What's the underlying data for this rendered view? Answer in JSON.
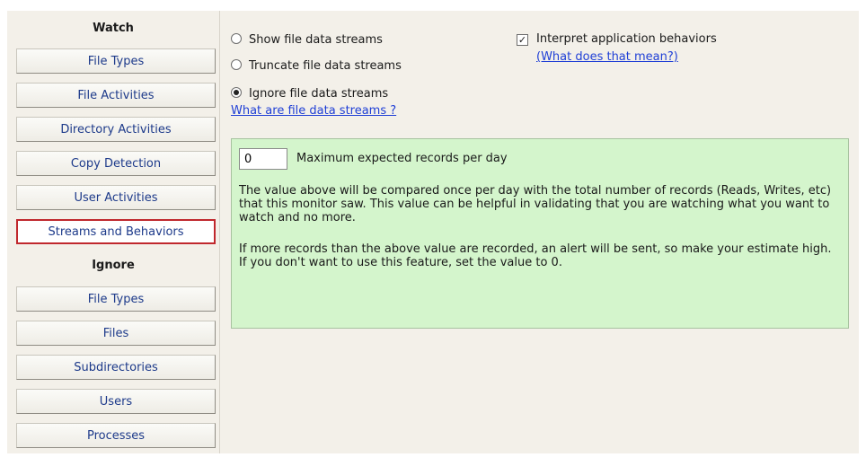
{
  "nav": {
    "watch_heading": "Watch",
    "watch_items": [
      {
        "label": "File Types"
      },
      {
        "label": "File Activities"
      },
      {
        "label": "Directory Activities"
      },
      {
        "label": "Copy Detection"
      },
      {
        "label": "User Activities"
      },
      {
        "label": "Streams and Behaviors",
        "selected": true
      }
    ],
    "ignore_heading": "Ignore",
    "ignore_items": [
      {
        "label": "File Types"
      },
      {
        "label": "Files"
      },
      {
        "label": "Subdirectories"
      },
      {
        "label": "Users"
      },
      {
        "label": "Processes"
      }
    ]
  },
  "streams": {
    "options": [
      {
        "label": "Show file data streams",
        "checked": false
      },
      {
        "label": "Truncate file data streams",
        "checked": false
      },
      {
        "label": "Ignore file data streams",
        "checked": true
      }
    ],
    "help_link": "What are file data streams ?"
  },
  "behaviors": {
    "checkbox_label": "Interpret application behaviors",
    "checked": true,
    "help_link": "(What does that mean?)"
  },
  "records": {
    "value": "0",
    "label": "Maximum expected records per day",
    "paragraph1": "The value above will be compared once per day with the total number of records (Reads, Writes, etc) that this monitor saw.  This value can be helpful in validating that you are watching what you want to watch and no more.",
    "paragraph2": "If more records than the above value are recorded, an alert will be sent, so make your estimate high.  If you don't want to use this feature, set the value to 0."
  },
  "colors": {
    "panel_bg": "#f3f0e9",
    "green_box": "#d4f5cc",
    "link": "#1f3fd6",
    "nav_text": "#1d3a8a",
    "selected_border": "#c0282d"
  }
}
